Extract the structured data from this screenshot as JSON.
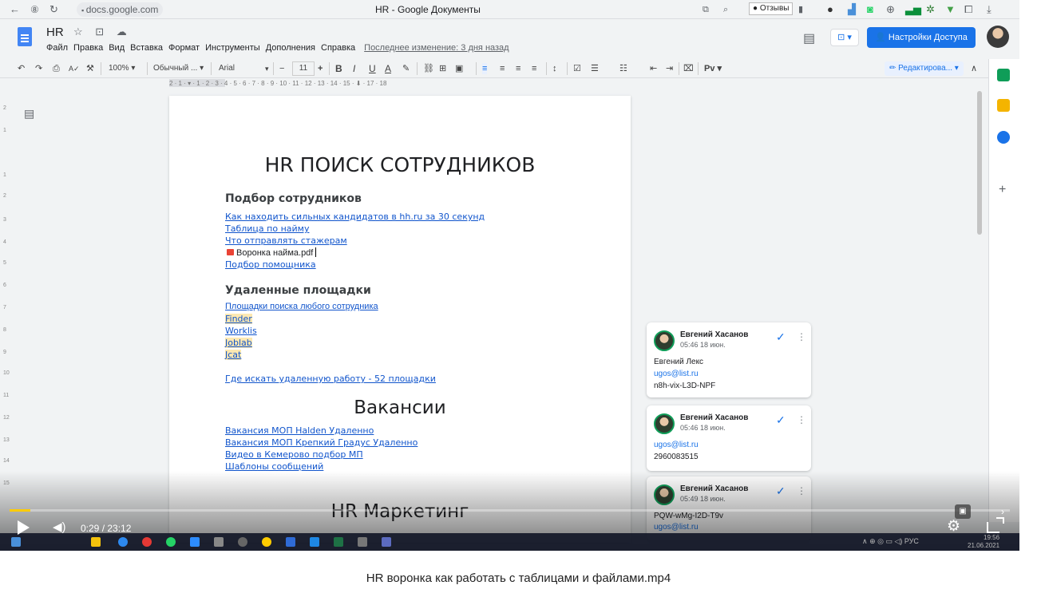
{
  "browser": {
    "back": "←",
    "shield": "⑧",
    "reload": "↻",
    "lock": "🔒",
    "url": "docs.google.com",
    "window_title": "HR - Google Документы",
    "reviews_label": "Отзывы"
  },
  "docs": {
    "title": "HR",
    "title_icons": "☆ ⊡ ☁",
    "menu": [
      "Файл",
      "Правка",
      "Вид",
      "Вставка",
      "Формат",
      "Инструменты",
      "Дополнения",
      "Справка"
    ],
    "last_edit": "Последнее изменение: 3 дня назад",
    "share_label": "Настройки Доступа",
    "present_label": "⊡ ▾"
  },
  "toolbar": {
    "undo": "↶",
    "redo": "↷",
    "print": "⎙",
    "spell": "A✓",
    "paint": "⚒",
    "zoom": "100%",
    "style": "Обычный ...",
    "font": "Arial",
    "size_minus": "−",
    "size": "11",
    "size_plus": "+",
    "bold": "B",
    "italic": "I",
    "underline": "U",
    "text_color": "A",
    "highlight": "✎",
    "link": "⛓",
    "comment": "⊞",
    "image": "▣",
    "align_left": "≡",
    "align_center": "≡",
    "align_right": "≡",
    "align_justify": "≡",
    "line_spacing": "↕",
    "checklist": "☑",
    "bullets": "☰",
    "numbers": "☷",
    "indent_less": "⇤",
    "indent_more": "⇥",
    "clear": "⌧",
    "input_tools": "Pv",
    "edit_mode": "✏ Редактирова... ▾",
    "collapse": "∧"
  },
  "ruler": {
    "marks": "2  ·  1  ·  ▾  ·  1  ·  2  ·  3  ·  4  ·  5  ·  6  ·  7  ·  8  ·  9  ·  10  ·  11  ·  12  ·  13  ·  14  ·  15  ·  ⬇  ·  17  ·  18"
  },
  "document": {
    "main_title": "HR ПОИСК СОТРУДНИКОВ",
    "section1": {
      "heading": "Подбор сотрудников",
      "links": [
        "Как находить сильных кандидатов в hh.ru за 30 секунд",
        "Таблица по найму",
        "Что отправлять стажерам"
      ],
      "attachment": "Воронка найма.pdf",
      "link_after": "Подбор помощника"
    },
    "section2": {
      "heading": "Удаленные площадки",
      "link_plain": "Площадки поиска любого сотрудника",
      "links": [
        "Finder",
        "Worklis",
        "Joblab",
        "Jcat"
      ],
      "extra_link": "Где искать удаленную работу - 52 площадки"
    },
    "vacancies_title": "Вакансии",
    "vacancy_links": [
      "Вакансия МОП Halden Удаленно",
      "Вакансия МОП Крепкий Градус Удаленно",
      "Видео в Кемерово подбор МП",
      "Шаблоны сообщений"
    ],
    "marketing_title": "HR Маркетинг"
  },
  "comments": [
    {
      "author": "Евгений Хасанов",
      "time": "05:46 18 июн.",
      "lines": [
        "Евгений Лекс",
        "ugos@list.ru",
        "n8h-vix-L3D-NPF"
      ]
    },
    {
      "author": "Евгений Хасанов",
      "time": "05:46 18 июн.",
      "lines": [
        "ugos@list.ru",
        "2960083515"
      ]
    },
    {
      "author": "Евгений Хасанов",
      "time": "05:49 18 июн.",
      "lines": [
        "PQW-wMg-I2D-T9v",
        "ugos@list.ru"
      ]
    }
  ],
  "player": {
    "time": "0:29 / 23:12",
    "progress": 0.021,
    "caption": "HR воронка как работать с таблицами и файлами.mp4"
  },
  "taskbar": {
    "tray": "∧  ⊕  ◎  ▭  ◁)  РУС",
    "time": "19:56",
    "date": "21.06.2021"
  },
  "colors": {
    "accent": "#1a73e8",
    "progress": "#ffcc00",
    "link": "#1155cc",
    "highlight": "#fce8b2"
  }
}
